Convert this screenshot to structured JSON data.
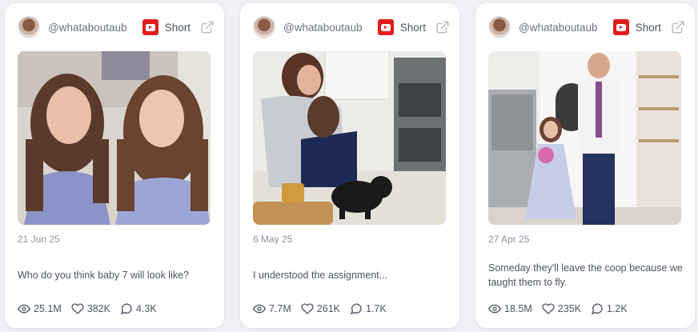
{
  "cards": [
    {
      "handle": "@whataboutaub",
      "platform": "youtube",
      "type_label": "Short",
      "date": "21 Jun 25",
      "caption": "Who do you think baby 7 will look like?",
      "stats": {
        "views": "25.1M",
        "likes": "382K",
        "comments": "4.3K"
      }
    },
    {
      "handle": "@whataboutaub",
      "platform": "youtube",
      "type_label": "Short",
      "date": "6 May 25",
      "caption": "I understood the assignment...",
      "stats": {
        "views": "7.7M",
        "likes": "261K",
        "comments": "1.7K"
      }
    },
    {
      "handle": "@whataboutaub",
      "platform": "youtube",
      "type_label": "Short",
      "date": "27 Apr 25",
      "caption": "Someday they'll leave the coop because we taught them to fly.",
      "stats": {
        "views": "18.5M",
        "likes": "235K",
        "comments": "1.2K"
      }
    }
  ],
  "icons": {
    "platform": "youtube-icon",
    "open": "external-link-icon",
    "views": "eye-icon",
    "likes": "heart-icon",
    "comments": "comment-icon"
  },
  "colors": {
    "page_bg": "#eef0f4",
    "card_bg": "#ffffff",
    "youtube_red": "#e11d1d",
    "text_primary": "#4b5563",
    "text_muted": "#8b93a1"
  }
}
